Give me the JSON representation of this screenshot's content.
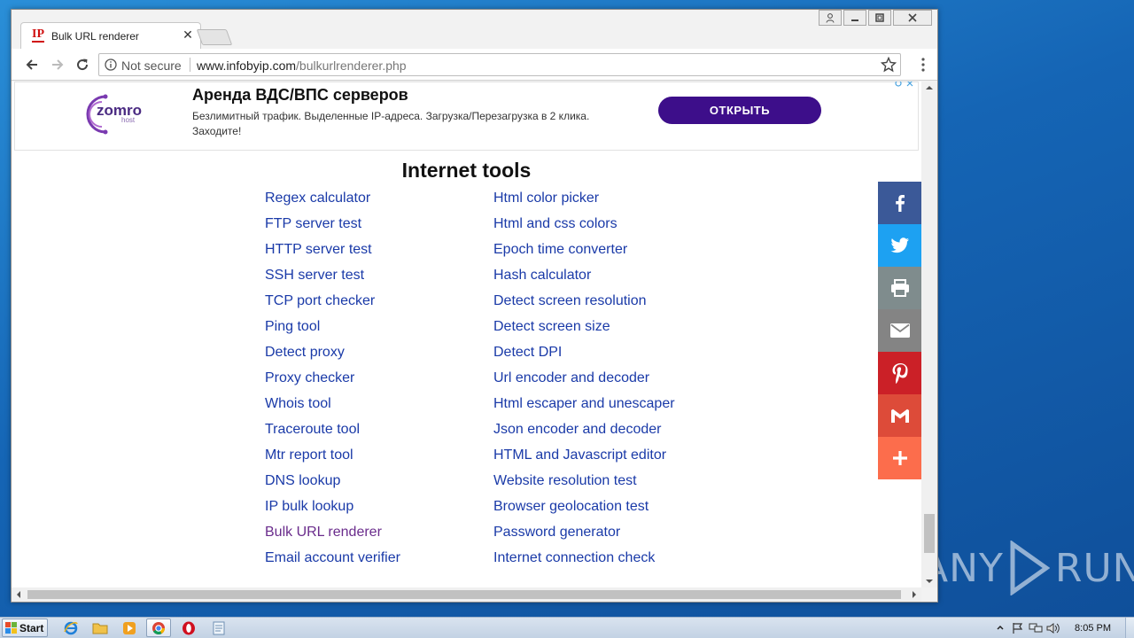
{
  "browser": {
    "tab_title": "Bulk URL renderer",
    "favicon_text": "IP",
    "security_label": "Not secure",
    "url_host": "www.infobyip.com",
    "url_path": "/bulkurlrenderer.php"
  },
  "ad": {
    "logo_text": "zomro",
    "logo_subtext": "host",
    "title": "Аренда ВДС/ВПС серверов",
    "description": "Безлимитный трафик. Выделенные IP-адреса. Загрузка/Перезагрузка в 2 клика. Заходите!",
    "button_label": "ОТКРЫТЬ",
    "brand_color": "#3d0e8a"
  },
  "page": {
    "section_title": "Internet tools",
    "link_color": "#1a3aa8",
    "visited_link_color": "#6a2c8c",
    "left_column": [
      "Regex calculator",
      "FTP server test",
      "HTTP server test",
      "SSH server test",
      "TCP port checker",
      "Ping tool",
      "Detect proxy",
      "Proxy checker",
      "Whois tool",
      "Traceroute tool",
      "Mtr report tool",
      "DNS lookup",
      "IP bulk lookup",
      "Bulk URL renderer",
      "Email account verifier"
    ],
    "right_column": [
      "Html color picker",
      "Html and css colors",
      "Epoch time converter",
      "Hash calculator",
      "Detect screen resolution",
      "Detect screen size",
      "Detect DPI",
      "Url encoder and decoder",
      "Html escaper and unescaper",
      "Json encoder and decoder",
      "HTML and Javascript editor",
      "Website resolution test",
      "Browser geolocation test",
      "Password generator",
      "Internet connection check"
    ],
    "visited_item": "Bulk URL renderer"
  },
  "share_bar": [
    {
      "name": "facebook",
      "icon": "facebook-icon",
      "color": "#3b5998"
    },
    {
      "name": "twitter",
      "icon": "twitter-icon",
      "color": "#1da1f2"
    },
    {
      "name": "print",
      "icon": "print-icon",
      "color": "#7f8c8d"
    },
    {
      "name": "email",
      "icon": "email-icon",
      "color": "#848484"
    },
    {
      "name": "pinterest",
      "icon": "pinterest-icon",
      "color": "#cb2027"
    },
    {
      "name": "gmail",
      "icon": "gmail-icon",
      "color": "#dd4b39"
    },
    {
      "name": "more",
      "icon": "plus-icon",
      "color": "#fc6d4c"
    }
  ],
  "taskbar": {
    "start_label": "Start",
    "clock": "8:05 PM"
  },
  "watermark": {
    "left": "ANY",
    "right": "RUN"
  }
}
